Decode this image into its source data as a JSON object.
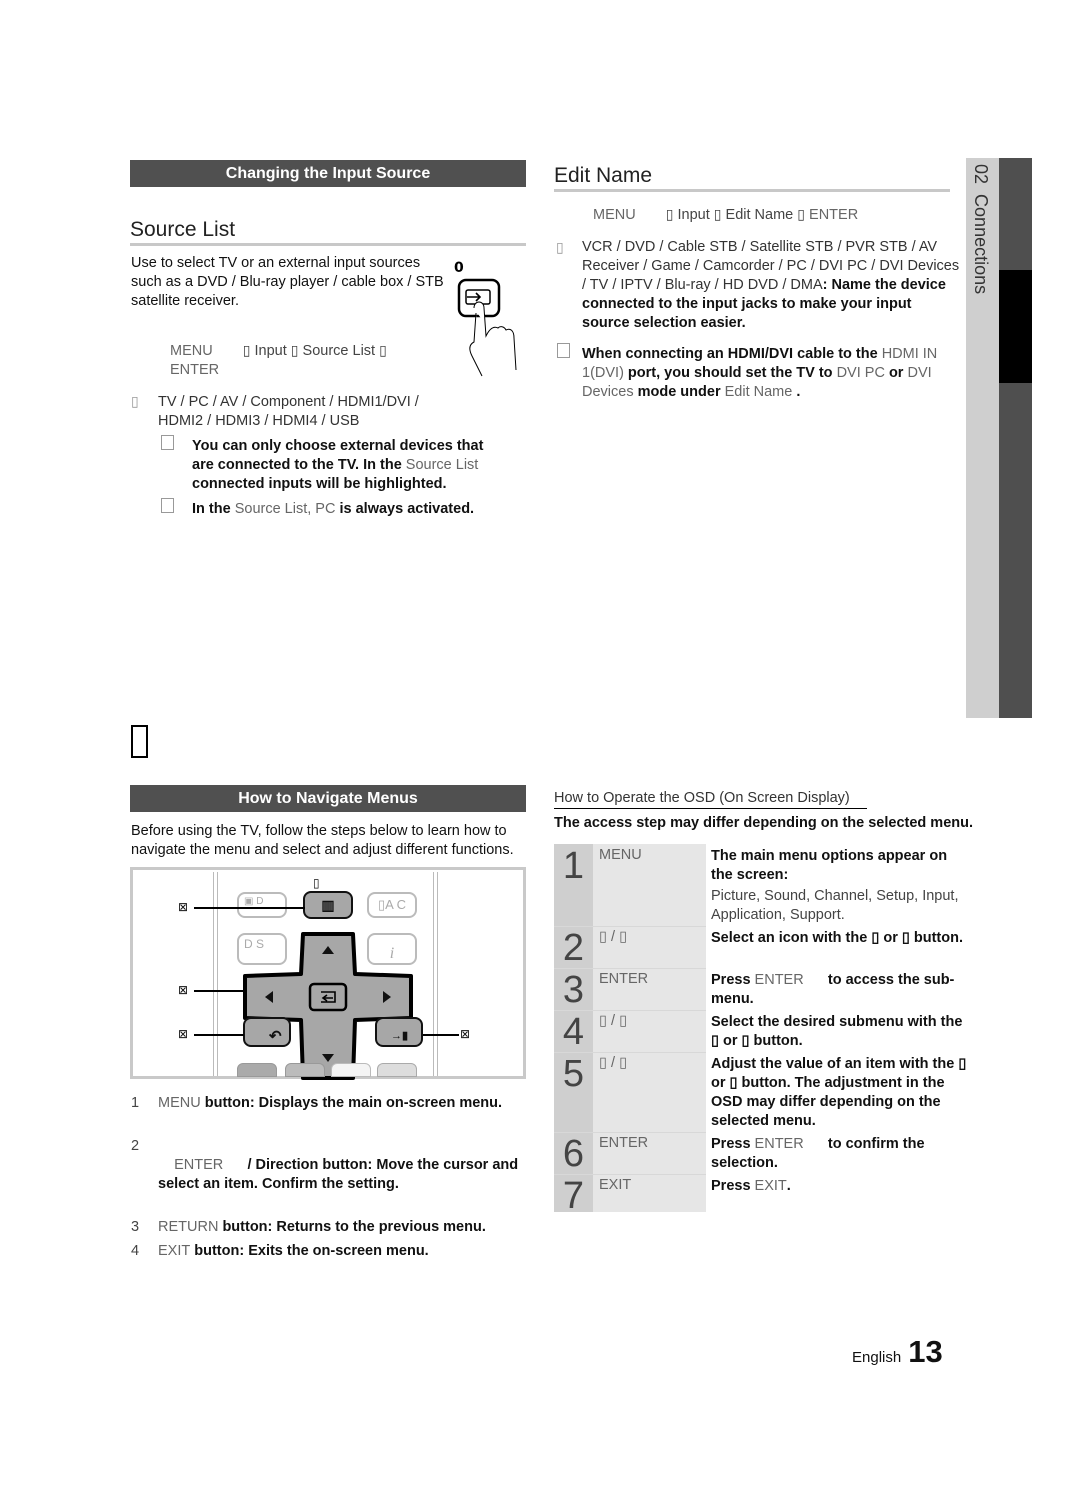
{
  "left_top": {
    "section_bar": "Changing the Input Source",
    "heading": "Source List",
    "intro": "Use to select TV or an external input sources such as a DVD / Blu-ray player / cable box / STB satellite receiver.",
    "path": {
      "menu": "MENU",
      "sep": "▯",
      "input": "Input",
      "source_list": "Source List",
      "enter": "ENTER"
    },
    "source_label": "▯",
    "sources_line1": "TV / PC / AV / Component / HDMI1/DVI /",
    "sources_line2": "HDMI2 / HDMI3 / HDMI4 / USB",
    "note1": {
      "a": "You can only choose external devices that are connected to the TV. In the ",
      "b": "Source List",
      "c": " connected inputs will be highlighted."
    },
    "note2": {
      "a": "In the ",
      "b": "Source List, PC",
      "c": " is always activated."
    }
  },
  "right_top": {
    "heading": "Edit Name",
    "path": {
      "menu": "MENU",
      "sep": "▯",
      "input": "Input",
      "edit_name": "Edit Name",
      "enter": "ENTER"
    },
    "bullet": "▯",
    "devices": "VCR / DVD / Cable STB / Satellite STB / PVR STB / AV Receiver / Game / Camcorder / PC / DVI PC / DVI Devices  / TV / IPTV / Blu-ray / HD DVD / DMA",
    "devices_bold": ": Name the device connected to the input jacks to make your input source selection easier.",
    "note": {
      "a": "When connecting an HDMI/DVI cable to the ",
      "b": "HDMI IN 1(DVI)",
      "c": " port, you should set the TV to ",
      "d": "DVI PC",
      "e": " or ",
      "f": "DVI Devices",
      "g": " mode under ",
      "h": "Edit Name",
      "i": " ."
    }
  },
  "side_tab": {
    "chapter": "02",
    "title": "Connections"
  },
  "left_bottom": {
    "big_glyph": "▯",
    "section_bar": "How to Navigate Menus",
    "intro": "Before using the TV, follow the steps below to learn how to navigate the menu and select and adjust different functions.",
    "remote_callout": "⊠",
    "remote_top_glyph": "▯",
    "buttons": {
      "menu_glyph": "▥",
      "tools_label": "▯A C",
      "left_top_label": "▣   D",
      "ds_label": "D   S",
      "info_label": "i",
      "return_glyph": "↶",
      "exit_glyph": "→▮",
      "enter_glyph": "↵"
    },
    "list": [
      {
        "num": "1",
        "key": "MENU",
        "text": " button: Displays the main on-screen menu."
      },
      {
        "num": "2",
        "key": "ENTER",
        "text": "      / Direction button: Move the cursor and select an item. Confirm the setting."
      },
      {
        "num": "3",
        "key": "RETURN",
        "text": " button: Returns to the previous menu."
      },
      {
        "num": "4",
        "key": "EXIT",
        "text": " button: Exits the on-screen menu."
      }
    ]
  },
  "right_bottom": {
    "subheading": "How to Operate the OSD (On Screen Display)",
    "intro": "The access step may differ depending on the selected menu.",
    "steps": [
      {
        "num": "1",
        "key": "MENU",
        "desc": "The main menu options appear on the screen:",
        "sub": "Picture, Sound, Channel, Setup, Input, Application, Support."
      },
      {
        "num": "2",
        "key": "▯  / ▯",
        "desc": "Select an icon with the ▯  or ▯ button."
      },
      {
        "num": "3",
        "key": "ENTER",
        "desc_a": "Press ",
        "desc_b": "ENTER",
        "desc_c": "      to access the sub-menu."
      },
      {
        "num": "4",
        "key": "▯  / ▯",
        "desc": "Select the desired submenu with the ▯  or ▯  button."
      },
      {
        "num": "5",
        "key": "▯  / ▯",
        "desc": "Adjust the value of an item with the ▯  or ▯  button. The adjustment in the OSD may differ depending on the selected menu."
      },
      {
        "num": "6",
        "key": "ENTER",
        "desc_a": "Press ",
        "desc_b": "ENTER",
        "desc_c": "      to confirm the selection."
      },
      {
        "num": "7",
        "key": "EXIT",
        "desc_a": "Press ",
        "desc_b": "EXIT",
        "desc_c": "."
      }
    ]
  },
  "footer": {
    "language": "English",
    "page": "13"
  }
}
